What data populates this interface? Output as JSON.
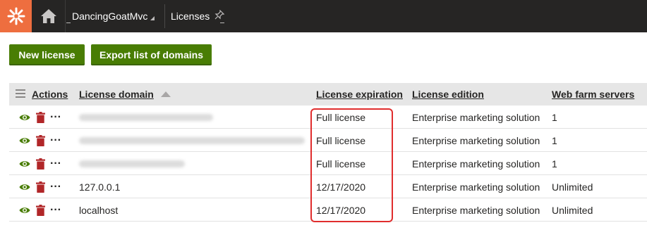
{
  "topbar": {
    "site_name": "DancingGoatMvc",
    "app_name": "Licenses"
  },
  "toolbar": {
    "new_license_label": "New license",
    "export_label": "Export list of domains"
  },
  "table": {
    "headers": {
      "actions": "Actions",
      "domain": "License domain",
      "expiration": "License expiration",
      "edition": "License edition",
      "servers": "Web farm servers"
    },
    "rows": [
      {
        "domain": "",
        "domain_hidden": true,
        "expiration": "Full license",
        "edition": "Enterprise marketing solution",
        "servers": "1"
      },
      {
        "domain": "",
        "domain_hidden": true,
        "expiration": "Full license",
        "edition": "Enterprise marketing solution",
        "servers": "1"
      },
      {
        "domain": "",
        "domain_hidden": true,
        "expiration": "Full license",
        "edition": "Enterprise marketing solution",
        "servers": "1"
      },
      {
        "domain": "127.0.0.1",
        "domain_hidden": false,
        "expiration": "12/17/2020",
        "edition": "Enterprise marketing solution",
        "servers": "Unlimited"
      },
      {
        "domain": "localhost",
        "domain_hidden": false,
        "expiration": "12/17/2020",
        "edition": "Enterprise marketing solution",
        "servers": "Unlimited"
      }
    ]
  },
  "colors": {
    "brand_orange": "#ee6e3f",
    "button_green": "#497d04",
    "view_icon_green": "#497d04",
    "delete_icon_red": "#b12628",
    "highlight_red": "#e02d2d"
  }
}
